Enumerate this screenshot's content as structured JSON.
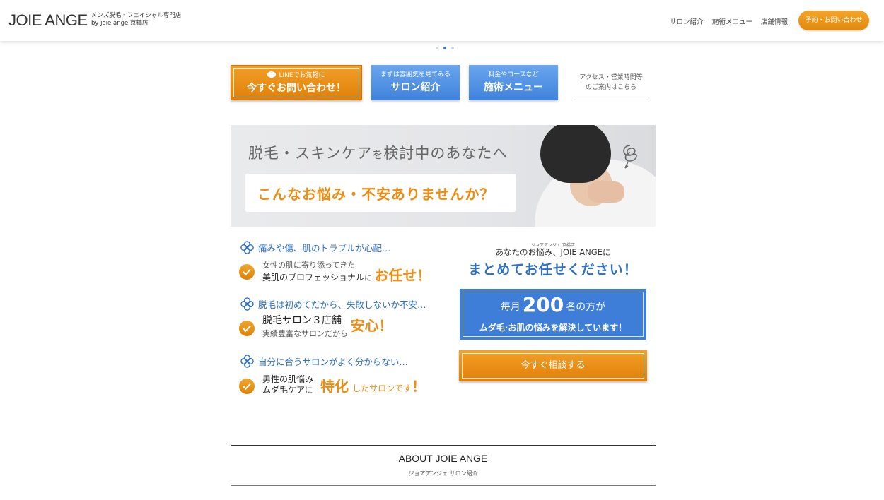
{
  "header": {
    "logo": "JOIE ANGE",
    "tagline_line1": "メンズ脱毛・フェイシャル専門店",
    "tagline_line2": "by joie ange 京橋店",
    "nav": [
      "サロン紹介",
      "施術メニュー",
      "店舗情報"
    ],
    "reserve_label": "予約・お問い合わせ"
  },
  "quick_buttons": {
    "line_small": "LINEでお気軽に",
    "line_big": "今すぐお問い合わせ！",
    "salon_small": "まずは雰囲気を見てみる",
    "salon_big": "サロン紹介",
    "menu_small": "料金やコースなど",
    "menu_big": "施術メニュー",
    "access_line1": "アクセス・営業時間等",
    "access_line2": "のご案内はこちら"
  },
  "banner": {
    "title_main": "脱毛・スキンケア",
    "title_particle": "を",
    "title_rest": "検討中のあなたへ",
    "question": "こんなお悩み・不安ありませんか？"
  },
  "concerns": [
    {
      "heading": "痛みや傷、肌のトラブルが心配…",
      "line1": "女性の肌に寄り添ってきた",
      "line2": "美肌のプロフェッショナル",
      "line2_particle": "に",
      "highlight": "お任せ！"
    },
    {
      "heading": "脱毛は初めてだから、失敗しないか不安…",
      "line1": "脱毛サロン３店舗",
      "line2": "実績豊富なサロンだから",
      "highlight": "安心！"
    },
    {
      "heading": "自分に合うサロンがよく分からない…",
      "line1": "男性の肌悩み",
      "line2": "ムダ毛ケア",
      "line2_particle": "に",
      "highlight": "特化",
      "highlight_tail": "したサロンです",
      "exclaim": "！"
    }
  ],
  "solution": {
    "small_label": "ジョアアンジェ 京橋店",
    "line1": "あなたのお悩み、JOIE ANGEに",
    "headline": "まとめてお任せください！",
    "count_prefix": "毎月",
    "count_number": "200",
    "count_suffix": "名の方が",
    "count_line2": "ムダ毛·お肌の悩みを解決しています！",
    "consult_label": "今すぐ相談する"
  },
  "about": {
    "title": "ABOUT JOIE ANGE",
    "subtitle": "ジョアアンジェ サロン紹介"
  },
  "colors": {
    "accent_orange": "#ee8c12",
    "accent_blue": "#2c6fc5",
    "button_blue": "#3e7ed8"
  }
}
